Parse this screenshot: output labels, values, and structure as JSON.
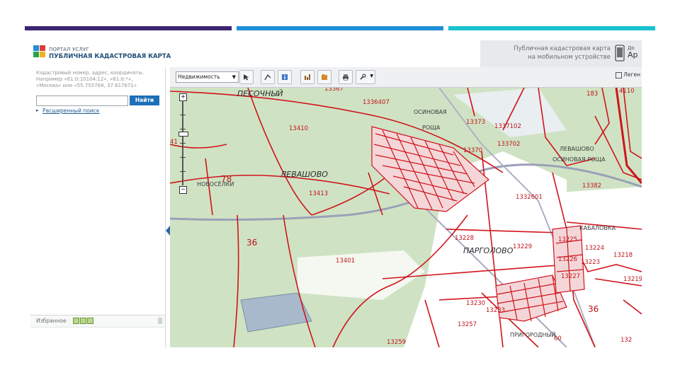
{
  "header": {
    "brand_small": "ПОРТАЛ УСЛУГ",
    "brand_big": "ПУБЛИЧНАЯ КАДАСТРОВАЯ КАРТА",
    "promo_line1": "Публичная кадастровая карта",
    "promo_line2": "на мобильном устройстве",
    "promo_cut_line1": "До",
    "promo_cut_line2": "Ap"
  },
  "search": {
    "hint_line1": "Кадастровый номер, адрес, координаты.",
    "hint_line2": "Например «61:0:10104:12», «61:0:*»,",
    "hint_line3": "«Москва» или «55.755768, 37.617671»",
    "input_value": "",
    "find_label": "Найти",
    "advanced_label": "Расширенный поиск"
  },
  "favorites": {
    "label": "Избранное"
  },
  "toolbar": {
    "layer_select": "Недвижимость",
    "legend_label": "Леген"
  },
  "map": {
    "places": {
      "pesochny": "ПЕСОЧНЫЙ",
      "osinovaya_roshcha": "ОСИНОВАЯ",
      "roshcha": "РОЩА",
      "levashovo": "ЛЕВАШОВО",
      "levashovo_right": "ЛЕВАШОВО",
      "osinovaya_roshcha_right": "ОСИНОВАЯ РОЩА",
      "novoselki": "НОВОСЁЛКИ",
      "pargolovo": "ПАРГОЛОВО",
      "kabalovka": "КАБАЛОВКА",
      "prigorodny": "ПРИГОРОДНЫЙ"
    },
    "parcels": {
      "p13367": "13367",
      "p1336407": "1336407",
      "p13410": "13410",
      "p13413": "13413",
      "p13401": "13401",
      "p13228": "13228",
      "p13370": "13370",
      "p13373": "13373",
      "p1337102": "1337102",
      "p133702": "133702",
      "p1332601": "1332601",
      "p13382": "13382",
      "p13224": "13224",
      "p13223": "13223",
      "p13218": "13218",
      "p13219": "13219",
      "p13230": "13230",
      "p13257": "13257",
      "p13259": "13259",
      "p13229": "13229",
      "p13225": "13225",
      "p13226": "13226",
      "p13227": "13227",
      "p13233": "13233",
      "p60": "60",
      "p78": "78",
      "p36a": "36",
      "p36b": "36",
      "p41": "41",
      "p183": "183",
      "p4110": "4110",
      "p132": "132"
    }
  },
  "colors": {
    "top_bar_purple": "#3b2470",
    "top_bar_blue": "#1e8fd8",
    "top_bar_cyan": "#19c3cf",
    "parcel_red": "#d0141c",
    "map_green": "#cfe3c4",
    "button_blue": "#1d6fb8"
  },
  "icons": [
    "logo-icon",
    "phone-icon",
    "chevron-down-icon",
    "cursor-icon",
    "info-icon",
    "chart-icon",
    "layers-icon",
    "print-icon",
    "wrench-icon",
    "zoom-in-icon",
    "zoom-out-icon"
  ]
}
